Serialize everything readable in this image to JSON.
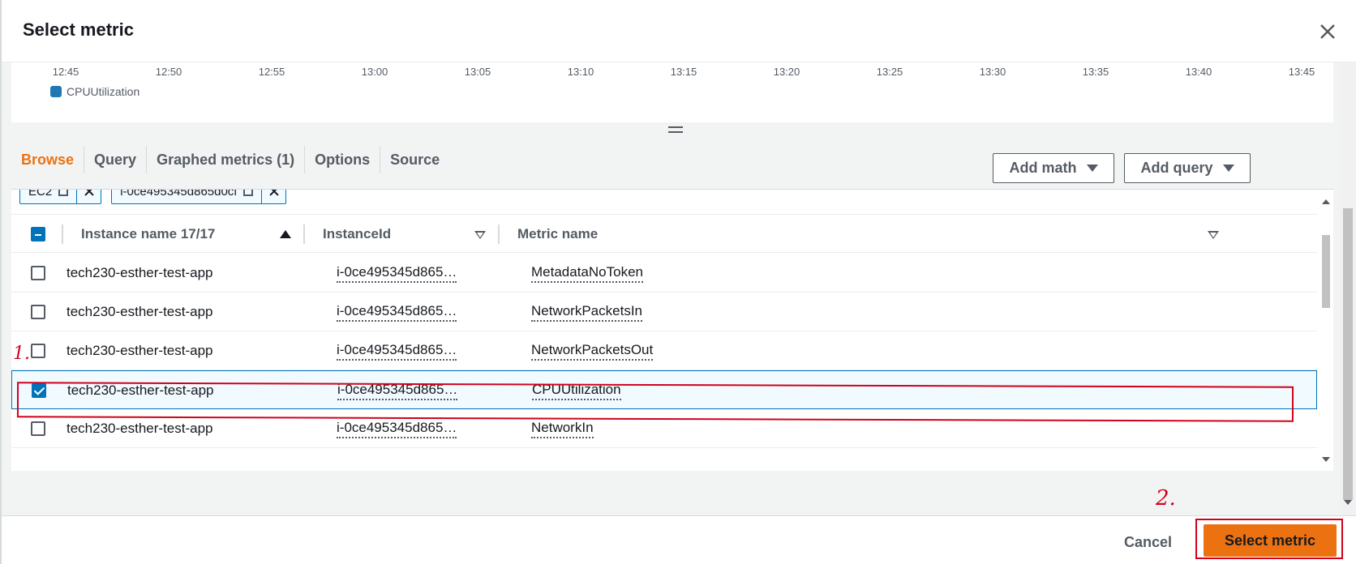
{
  "dialog": {
    "title": "Select metric"
  },
  "chart": {
    "tick_labels": [
      "12:45",
      "12:50",
      "12:55",
      "13:00",
      "13:05",
      "13:10",
      "13:15",
      "13:20",
      "13:25",
      "13:30",
      "13:35",
      "13:40",
      "13:45"
    ],
    "legend_label": "CPUUtilization",
    "legend_color": "#1f77b4"
  },
  "tabs": {
    "browse": "Browse",
    "query": "Query",
    "graphed": "Graphed metrics (1)",
    "options": "Options",
    "source": "Source"
  },
  "actions": {
    "add_math": "Add math",
    "add_query": "Add query"
  },
  "filters": {
    "token1": "EC2",
    "token2": "i-0ce495345d865d0cf"
  },
  "table": {
    "columns": {
      "instance_name": "Instance name 17/17",
      "instance_id": "InstanceId",
      "metric_name": "Metric name"
    },
    "rows": [
      {
        "instance_name": "tech230-esther-test-app",
        "instance_id": "i-0ce495345d865…",
        "metric_name": "MetadataNoToken",
        "checked": false
      },
      {
        "instance_name": "tech230-esther-test-app",
        "instance_id": "i-0ce495345d865…",
        "metric_name": "NetworkPacketsIn",
        "checked": false
      },
      {
        "instance_name": "tech230-esther-test-app",
        "instance_id": "i-0ce495345d865…",
        "metric_name": "NetworkPacketsOut",
        "checked": false
      },
      {
        "instance_name": "tech230-esther-test-app",
        "instance_id": "i-0ce495345d865…",
        "metric_name": "CPUUtilization",
        "checked": true
      },
      {
        "instance_name": "tech230-esther-test-app",
        "instance_id": "i-0ce495345d865…",
        "metric_name": "NetworkIn",
        "checked": false
      }
    ]
  },
  "footer": {
    "cancel": "Cancel",
    "select": "Select metric"
  },
  "annotations": {
    "step1": "1.",
    "step2": "2."
  },
  "colors": {
    "accent": "#ec7211",
    "link": "#0073bb",
    "annotation": "#d0021b"
  }
}
